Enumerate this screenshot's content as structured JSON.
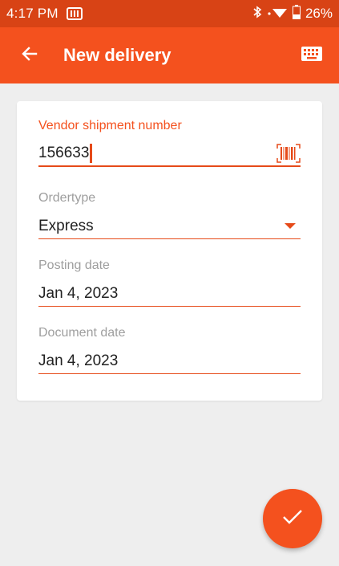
{
  "status_bar": {
    "time": "4:17 PM",
    "battery": "26%",
    "icons": [
      "sim-card-icon",
      "bluetooth-icon",
      "wifi-icon",
      "battery-icon"
    ]
  },
  "app_bar": {
    "title": "New delivery",
    "back_icon": "arrow-back-icon",
    "keyboard_icon": "keyboard-icon"
  },
  "form": {
    "vendor_shipment": {
      "label": "Vendor shipment number",
      "value": "156633"
    },
    "ordertype": {
      "label": "Ordertype",
      "value": "Express"
    },
    "posting_date": {
      "label": "Posting date",
      "value": "Jan 4, 2023"
    },
    "document_date": {
      "label": "Document date",
      "value": "Jan 4, 2023"
    }
  },
  "fab": {
    "icon": "check-icon"
  },
  "colors": {
    "accent": "#f4511e",
    "status_bar": "#d84315",
    "background": "#eeeeee"
  }
}
